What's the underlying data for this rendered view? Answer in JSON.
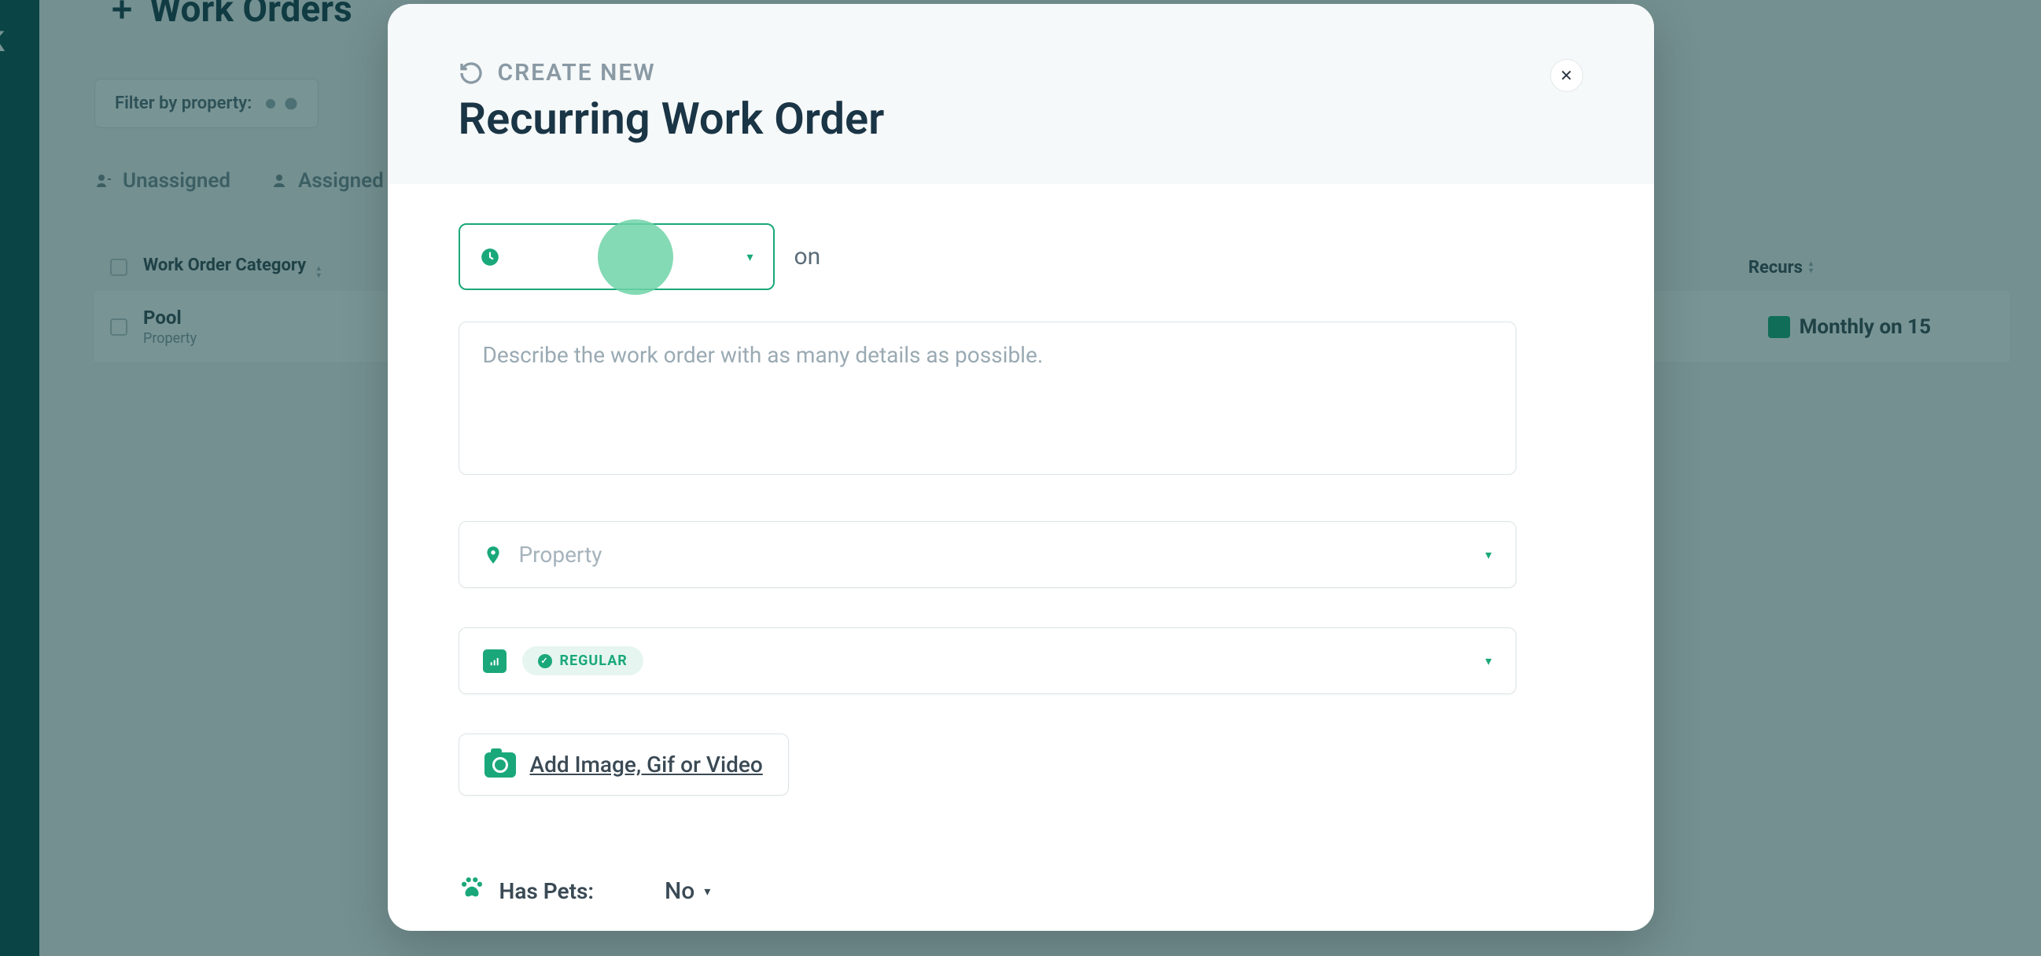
{
  "background": {
    "page_title": "Work Orders",
    "filter_label": "Filter by property:",
    "tabs": {
      "unassigned": "Unassigned",
      "assigned": "Assigned"
    },
    "table": {
      "header_category": "Work Order Category",
      "header_recurs": "Recurs",
      "row": {
        "title": "Pool",
        "subtitle": "Property",
        "recurs_value": "Monthly on 15"
      }
    }
  },
  "modal": {
    "overline": "CREATE NEW",
    "title": "Recurring Work Order",
    "close_symbol": "✕",
    "frequency": {
      "on_label": "on"
    },
    "description_placeholder": "Describe the work order with as many details as possible.",
    "property_placeholder": "Property",
    "priority_value": "REGULAR",
    "add_media_label": "Add Image, Gif or Video",
    "has_pets": {
      "label": "Has Pets:",
      "value": "No"
    }
  }
}
